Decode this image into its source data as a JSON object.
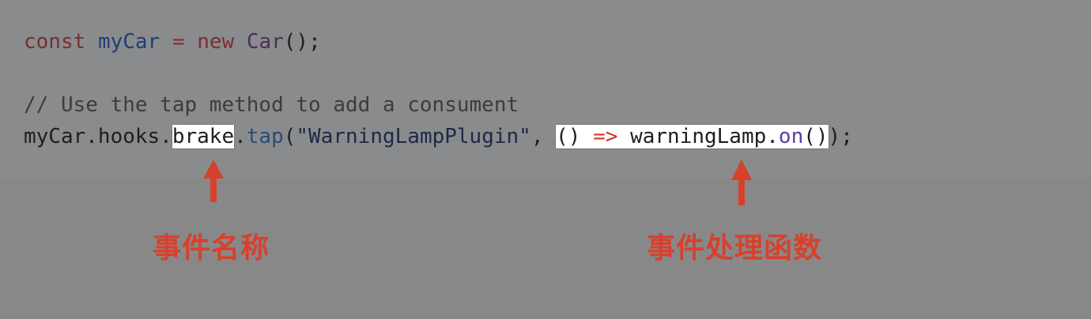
{
  "code": {
    "line1": {
      "kw_const": "const",
      "var_name": "myCar",
      "eq": "=",
      "kw_new": "new",
      "cls": "Car",
      "tail": "();"
    },
    "line3": {
      "comment": "// Use the tap method to add a consument"
    },
    "line4": {
      "obj": "myCar.hooks.",
      "hook": "brake",
      "dot": ".",
      "tap": "tap",
      "open": "(",
      "str": "\"WarningLampPlugin\"",
      "comma": ", ",
      "parens": "()",
      "arrow": "=>",
      "call_obj": "warningLamp.",
      "call_fn": "on",
      "call_parens": "()",
      "close": ");"
    }
  },
  "annotations": {
    "hook_label": "事件名称",
    "handler_label": "事件处理函数",
    "arrow_color": "#d7412c"
  }
}
